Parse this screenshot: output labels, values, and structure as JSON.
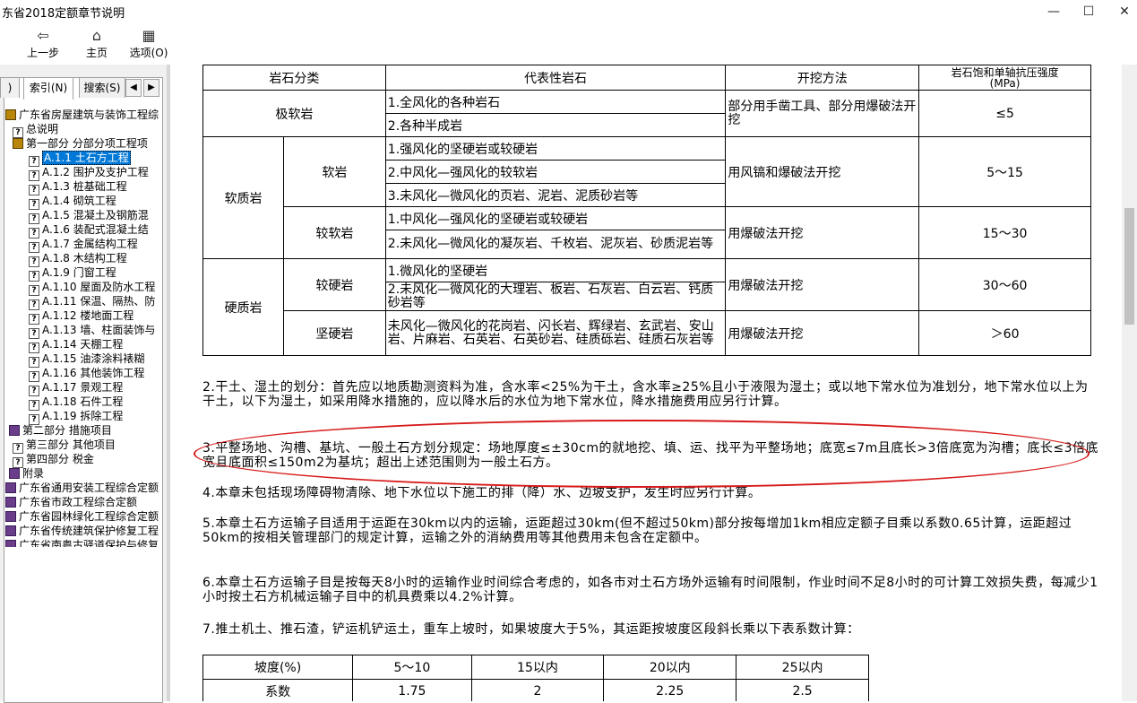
{
  "window": {
    "title": "东省2018定额章节说明"
  },
  "toolbar": {
    "back_label": "上一步",
    "home_label": "主页",
    "options_label": "选项(O)"
  },
  "tabs": {
    "tab0": "",
    "index": "索引(N)",
    "search": "搜索(S)"
  },
  "tree": {
    "root": "广东省房屋建筑与装饰工程综",
    "overview": "总说明",
    "part1": "第一部分 分部分项工程项",
    "items": [
      "A.1.1 土石方工程",
      "A.1.2 围护及支护工程",
      "A.1.3 桩基础工程",
      "A.1.4 砌筑工程",
      "A.1.5 混凝土及钢筋混",
      "A.1.6 装配式混凝土结",
      "A.1.7 金属结构工程",
      "A.1.8 木结构工程",
      "A.1.9 门窗工程",
      "A.1.10 屋面及防水工程",
      "A.1.11 保温、隔热、防",
      "A.1.12 楼地面工程",
      "A.1.13 墙、柱面装饰与",
      "A.1.14 天棚工程",
      "A.1.15 油漆涂料裱糊",
      "A.1.16 其他装饰工程",
      "A.1.17 景观工程",
      "A.1.18 石件工程",
      "A.1.19 拆除工程"
    ],
    "part2": "第二部分 措施项目",
    "part3": "第三部分 其他项目",
    "part4": "第四部分 税金",
    "appendix": "附录",
    "others": [
      "广东省通用安装工程综合定额",
      "广东省市政工程综合定额",
      "广东省园林绿化工程综合定额",
      "广东省传统建筑保护修复工程",
      "广东省南粤古驿道保护与修复"
    ]
  },
  "rock_table": {
    "headers": [
      "岩石分类",
      "代表性岩石",
      "开挖方法",
      "岩石饱和单轴抗压强度",
      "(MPa)"
    ],
    "r1": {
      "cat": "极软岩",
      "a": "1.全风化的各种岩石",
      "b": "2.各种半成岩",
      "method": "部分用手凿工具、部分用爆破法开挖",
      "strength": "≤5"
    },
    "soft": {
      "cat": "软质岩"
    },
    "r2": {
      "sub": "软岩",
      "a": "1.强风化的坚硬岩或较硬岩",
      "b": "2.中风化—强风化的较软岩",
      "c": "3.未风化—微风化的页岩、泥岩、泥质砂岩等",
      "method": "用风镐和爆破法开挖",
      "strength": "5～15"
    },
    "r3": {
      "sub": "较软岩",
      "a": "1.中风化—强风化的坚硬岩或较硬岩",
      "b": "2.未风化—微风化的凝灰岩、千枚岩、泥灰岩、砂质泥岩等",
      "method": "用爆破法开挖",
      "strength": "15～30"
    },
    "hard": {
      "cat": "硬质岩"
    },
    "r4": {
      "sub": "较硬岩",
      "a": "1.微风化的坚硬岩",
      "b": "2.未风化—微风化的大理岩、板岩、石灰岩、白云岩、钙质砂岩等",
      "method": "用爆破法开挖",
      "strength": "30～60"
    },
    "r5": {
      "sub": "坚硬岩",
      "a": "未风化—微风化的花岗岩、闪长岩、辉绿岩、玄武岩、安山岩、片麻岩、石英岩、石英砂岩、硅质砾岩、硅质石灰岩等",
      "method": "用爆破法开挖",
      "strength": "＞60"
    }
  },
  "paragraphs": {
    "p2": "2.干土、湿土的划分：首先应以地质勘测资料为准，含水率<25%为干土，含水率≥25%且小于液限为湿土；或以地下常水位为准划分，地下常水位以上为干土，以下为湿土，如采用降水措施的，应以降水后的水位为地下常水位，降水措施费用应另行计算。",
    "p3": "3.平整场地、沟槽、基坑、一般土石方划分规定：场地厚度≤±30cm的就地挖、填、运、找平为平整场地；底宽≤7m且底长>3倍底宽为沟槽；底长≤3倍底宽且底面积≤150m2为基坑；超出上述范围则为一般土石方。",
    "p4": "4.本章未包括现场障碍物清除、地下水位以下施工的排（降）水、边坡支护，发生时应另行计算。",
    "p5": "5.本章土石方运输子目适用于运距在30km以内的运输，运距超过30km(但不超过50km)部分按每增加1km相应定额子目乘以系数0.65计算，运距超过50km的按相关管理部门的规定计算，运输之外的消納费用等其他费用未包含在定额中。",
    "p6": "6.本章土石方运输子目是按每天8小时的运输作业时间综合考虑的，如各市对土石方场外运输有时间限制，作业时间不足8小时的可计算工效损失费，每减少1小时按土石方机械运输子目中的机具费乘以4.2%计算。",
    "p7": "7.推土机土、推石渣，铲运机铲运土，重车上坡时，如果坡度大于5%，其运距按坡度区段斜长乘以下表系数计算："
  },
  "coef_table": {
    "head": [
      "坡度(%)",
      "5～10",
      "15以内",
      "20以内",
      "25以内"
    ],
    "vals": [
      "系数",
      "1.75",
      "2",
      "2.25",
      "2.5"
    ]
  },
  "annotation_color": "#d71a1a",
  "selection_color": "#0078d7"
}
